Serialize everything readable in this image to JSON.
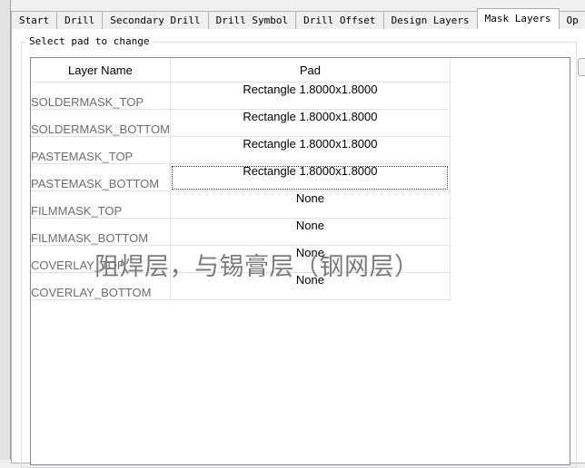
{
  "tabs": [
    {
      "label": "Start",
      "active": false
    },
    {
      "label": "Drill",
      "active": false
    },
    {
      "label": "Secondary Drill",
      "active": false
    },
    {
      "label": "Drill Symbol",
      "active": false
    },
    {
      "label": "Drill Offset",
      "active": false
    },
    {
      "label": "Design Layers",
      "active": false
    },
    {
      "label": "Mask Layers",
      "active": true
    },
    {
      "label": "Op",
      "active": false
    }
  ],
  "group": {
    "caption": "Select pad to change"
  },
  "grid": {
    "columns": [
      "Layer Name",
      "Pad"
    ],
    "rows": [
      {
        "layer": "SOLDERMASK_TOP",
        "pad": "Rectangle 1.8000x1.8000"
      },
      {
        "layer": "SOLDERMASK_BOTTOM",
        "pad": "Rectangle 1.8000x1.8000"
      },
      {
        "layer": "PASTEMASK_TOP",
        "pad": "Rectangle 1.8000x1.8000"
      },
      {
        "layer": "PASTEMASK_BOTTOM",
        "pad": "Rectangle 1.8000x1.8000"
      },
      {
        "layer": "FILMMASK_TOP",
        "pad": "None"
      },
      {
        "layer": "FILMMASK_BOTTOM",
        "pad": "None"
      },
      {
        "layer": "COVERLAY_TOP",
        "pad": "None"
      },
      {
        "layer": "COVERLAY_BOTTOM",
        "pad": "None"
      }
    ]
  },
  "annotation": "阻焊层，与锡膏层（钢网层）"
}
